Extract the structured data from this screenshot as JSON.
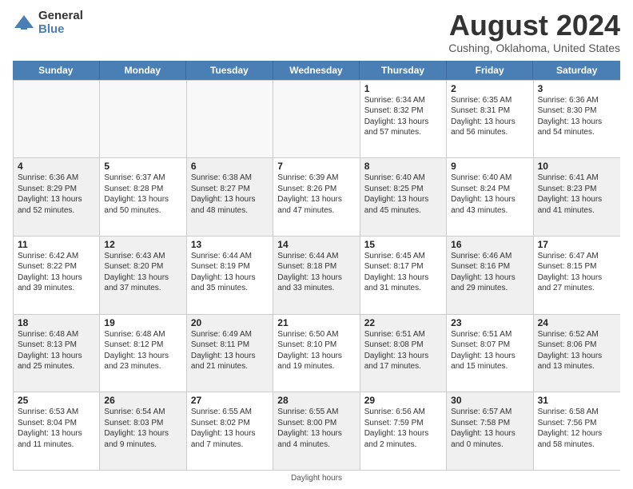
{
  "logo": {
    "general": "General",
    "blue": "Blue"
  },
  "title": "August 2024",
  "location": "Cushing, Oklahoma, United States",
  "weekdays": [
    "Sunday",
    "Monday",
    "Tuesday",
    "Wednesday",
    "Thursday",
    "Friday",
    "Saturday"
  ],
  "footer": "Daylight hours",
  "weeks": [
    [
      {
        "day": "",
        "text": "",
        "empty": true
      },
      {
        "day": "",
        "text": "",
        "empty": true
      },
      {
        "day": "",
        "text": "",
        "empty": true
      },
      {
        "day": "",
        "text": "",
        "empty": true
      },
      {
        "day": "1",
        "text": "Sunrise: 6:34 AM\nSunset: 8:32 PM\nDaylight: 13 hours and 57 minutes."
      },
      {
        "day": "2",
        "text": "Sunrise: 6:35 AM\nSunset: 8:31 PM\nDaylight: 13 hours and 56 minutes."
      },
      {
        "day": "3",
        "text": "Sunrise: 6:36 AM\nSunset: 8:30 PM\nDaylight: 13 hours and 54 minutes."
      }
    ],
    [
      {
        "day": "4",
        "text": "Sunrise: 6:36 AM\nSunset: 8:29 PM\nDaylight: 13 hours and 52 minutes.",
        "shaded": true
      },
      {
        "day": "5",
        "text": "Sunrise: 6:37 AM\nSunset: 8:28 PM\nDaylight: 13 hours and 50 minutes."
      },
      {
        "day": "6",
        "text": "Sunrise: 6:38 AM\nSunset: 8:27 PM\nDaylight: 13 hours and 48 minutes.",
        "shaded": true
      },
      {
        "day": "7",
        "text": "Sunrise: 6:39 AM\nSunset: 8:26 PM\nDaylight: 13 hours and 47 minutes."
      },
      {
        "day": "8",
        "text": "Sunrise: 6:40 AM\nSunset: 8:25 PM\nDaylight: 13 hours and 45 minutes.",
        "shaded": true
      },
      {
        "day": "9",
        "text": "Sunrise: 6:40 AM\nSunset: 8:24 PM\nDaylight: 13 hours and 43 minutes."
      },
      {
        "day": "10",
        "text": "Sunrise: 6:41 AM\nSunset: 8:23 PM\nDaylight: 13 hours and 41 minutes.",
        "shaded": true
      }
    ],
    [
      {
        "day": "11",
        "text": "Sunrise: 6:42 AM\nSunset: 8:22 PM\nDaylight: 13 hours and 39 minutes."
      },
      {
        "day": "12",
        "text": "Sunrise: 6:43 AM\nSunset: 8:20 PM\nDaylight: 13 hours and 37 minutes.",
        "shaded": true
      },
      {
        "day": "13",
        "text": "Sunrise: 6:44 AM\nSunset: 8:19 PM\nDaylight: 13 hours and 35 minutes."
      },
      {
        "day": "14",
        "text": "Sunrise: 6:44 AM\nSunset: 8:18 PM\nDaylight: 13 hours and 33 minutes.",
        "shaded": true
      },
      {
        "day": "15",
        "text": "Sunrise: 6:45 AM\nSunset: 8:17 PM\nDaylight: 13 hours and 31 minutes."
      },
      {
        "day": "16",
        "text": "Sunrise: 6:46 AM\nSunset: 8:16 PM\nDaylight: 13 hours and 29 minutes.",
        "shaded": true
      },
      {
        "day": "17",
        "text": "Sunrise: 6:47 AM\nSunset: 8:15 PM\nDaylight: 13 hours and 27 minutes."
      }
    ],
    [
      {
        "day": "18",
        "text": "Sunrise: 6:48 AM\nSunset: 8:13 PM\nDaylight: 13 hours and 25 minutes.",
        "shaded": true
      },
      {
        "day": "19",
        "text": "Sunrise: 6:48 AM\nSunset: 8:12 PM\nDaylight: 13 hours and 23 minutes."
      },
      {
        "day": "20",
        "text": "Sunrise: 6:49 AM\nSunset: 8:11 PM\nDaylight: 13 hours and 21 minutes.",
        "shaded": true
      },
      {
        "day": "21",
        "text": "Sunrise: 6:50 AM\nSunset: 8:10 PM\nDaylight: 13 hours and 19 minutes."
      },
      {
        "day": "22",
        "text": "Sunrise: 6:51 AM\nSunset: 8:08 PM\nDaylight: 13 hours and 17 minutes.",
        "shaded": true
      },
      {
        "day": "23",
        "text": "Sunrise: 6:51 AM\nSunset: 8:07 PM\nDaylight: 13 hours and 15 minutes."
      },
      {
        "day": "24",
        "text": "Sunrise: 6:52 AM\nSunset: 8:06 PM\nDaylight: 13 hours and 13 minutes.",
        "shaded": true
      }
    ],
    [
      {
        "day": "25",
        "text": "Sunrise: 6:53 AM\nSunset: 8:04 PM\nDaylight: 13 hours and 11 minutes."
      },
      {
        "day": "26",
        "text": "Sunrise: 6:54 AM\nSunset: 8:03 PM\nDaylight: 13 hours and 9 minutes.",
        "shaded": true
      },
      {
        "day": "27",
        "text": "Sunrise: 6:55 AM\nSunset: 8:02 PM\nDaylight: 13 hours and 7 minutes."
      },
      {
        "day": "28",
        "text": "Sunrise: 6:55 AM\nSunset: 8:00 PM\nDaylight: 13 hours and 4 minutes.",
        "shaded": true
      },
      {
        "day": "29",
        "text": "Sunrise: 6:56 AM\nSunset: 7:59 PM\nDaylight: 13 hours and 2 minutes."
      },
      {
        "day": "30",
        "text": "Sunrise: 6:57 AM\nSunset: 7:58 PM\nDaylight: 13 hours and 0 minutes.",
        "shaded": true
      },
      {
        "day": "31",
        "text": "Sunrise: 6:58 AM\nSunset: 7:56 PM\nDaylight: 12 hours and 58 minutes."
      }
    ]
  ]
}
